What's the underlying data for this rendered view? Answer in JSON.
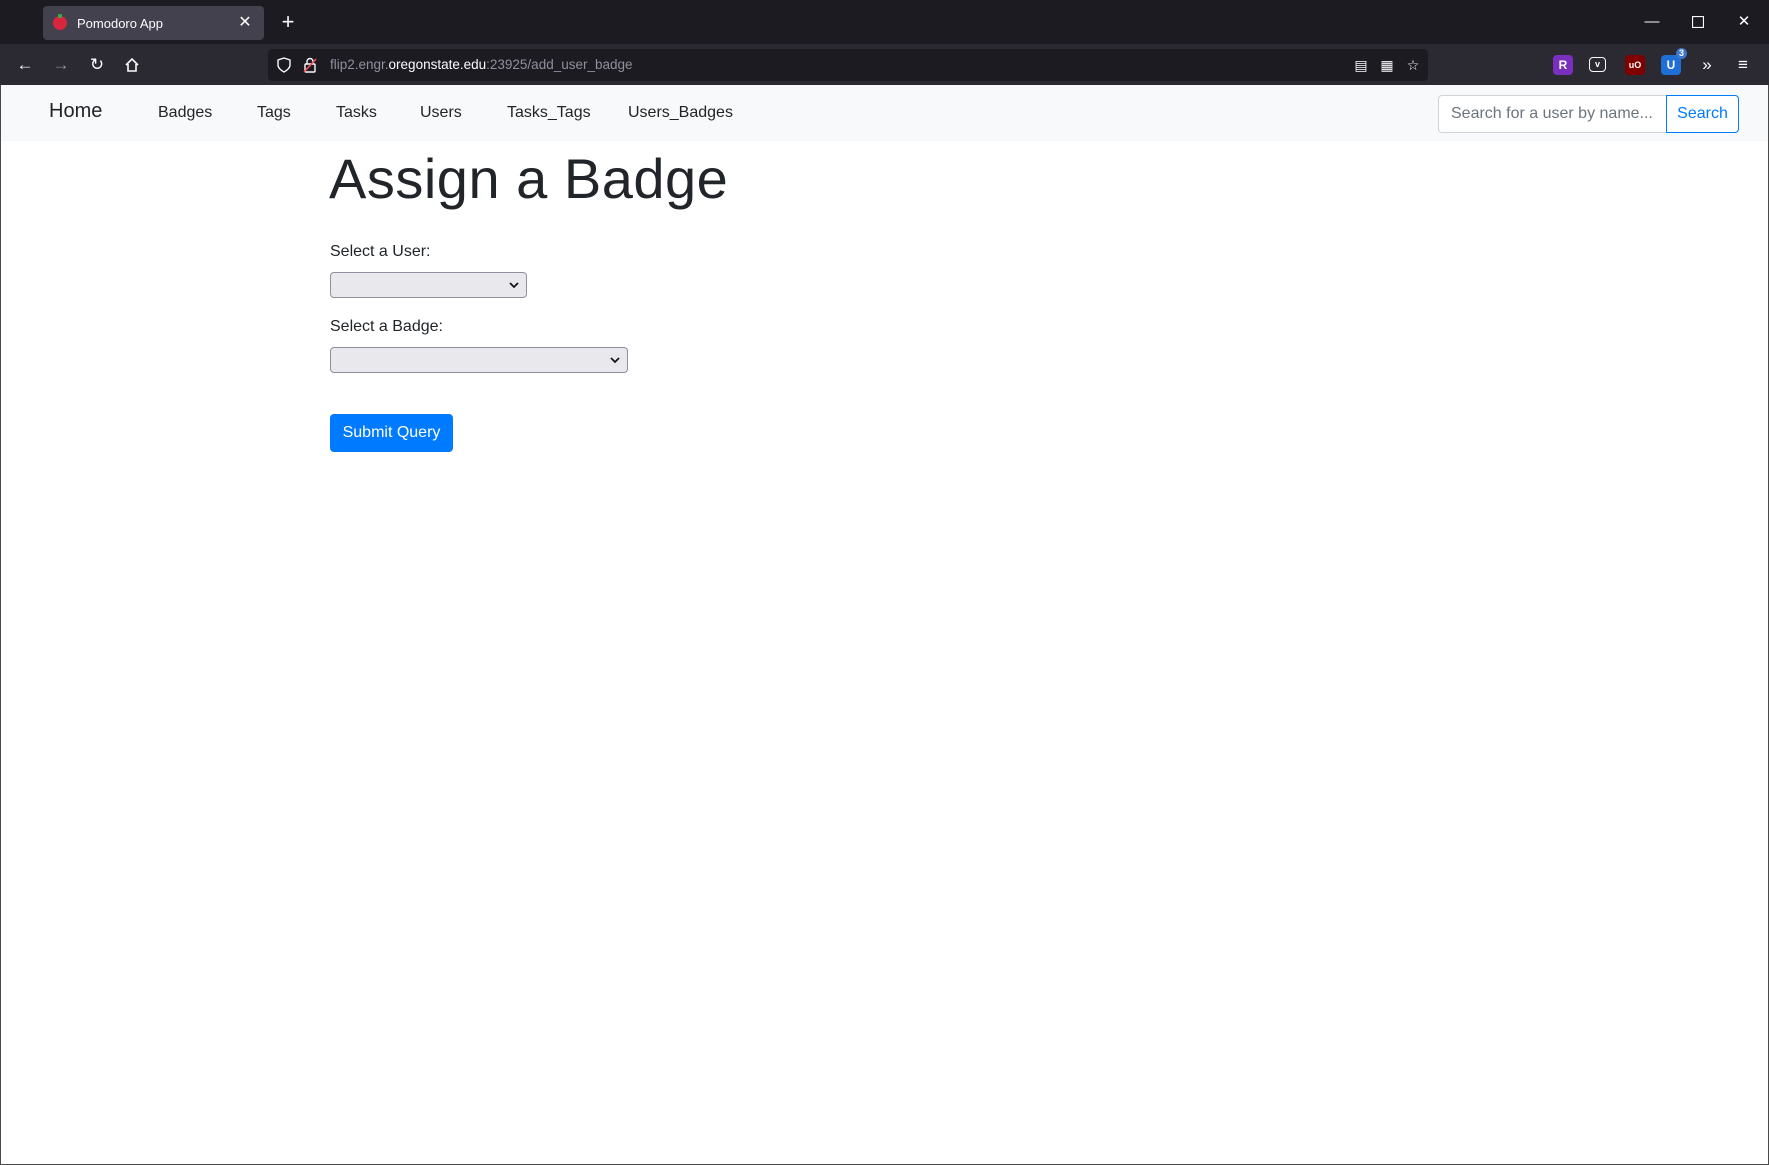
{
  "browser": {
    "tab_title": "Pomodoro App",
    "url_prefix": "flip2.engr.",
    "url_host": "oregonstate.edu",
    "url_suffix": ":23925/add_user_badge",
    "extension_badge": "3"
  },
  "site": {
    "brand": "Home",
    "nav_links": [
      "Badges",
      "Tags",
      "Tasks",
      "Users",
      "Tasks_Tags",
      "Users_Badges"
    ],
    "search_placeholder": "Search for a user by name...",
    "search_button": "Search"
  },
  "form": {
    "title": "Assign a Badge",
    "user_label": "Select a User:",
    "user_value": "",
    "badge_label": "Select a Badge:",
    "badge_value": "",
    "submit_label": "Submit Query"
  },
  "colors": {
    "primary": "#007bff",
    "navbar_bg": "#f8f9fa",
    "chrome_bg": "#1c1b22"
  }
}
